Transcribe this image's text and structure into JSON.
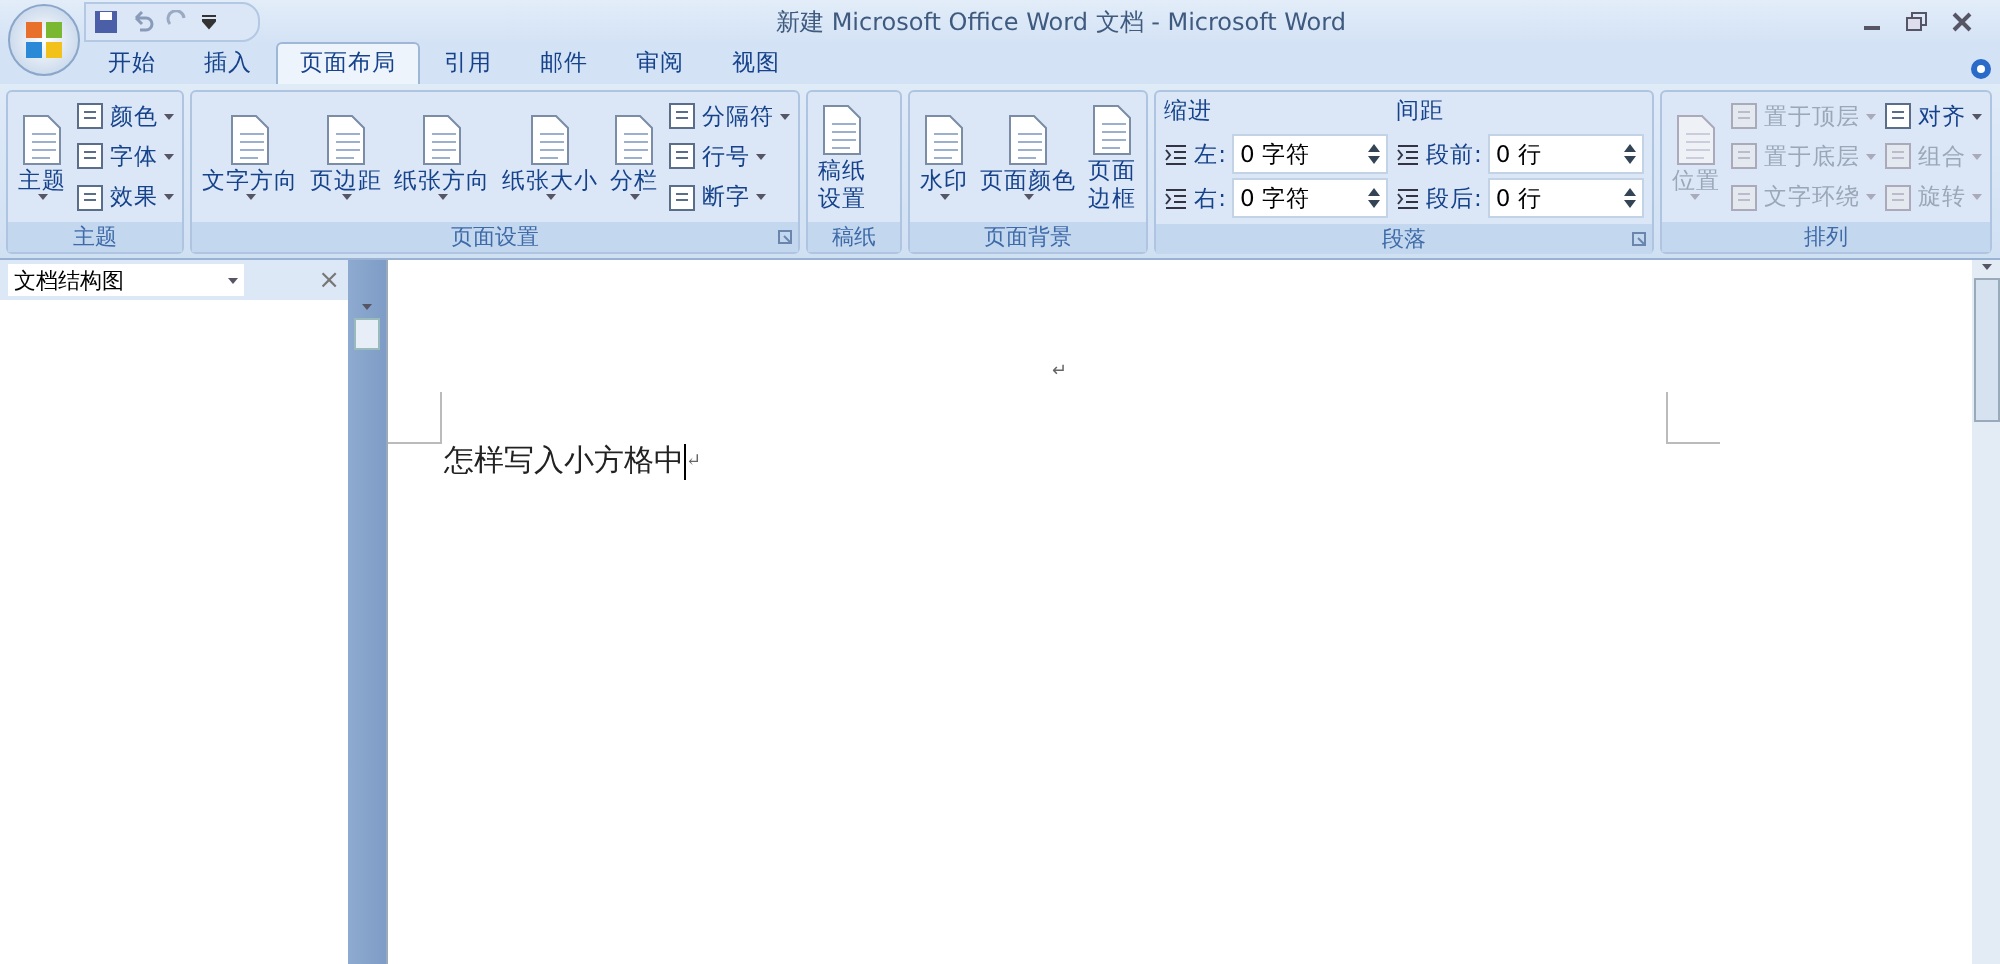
{
  "window": {
    "title": "新建 Microsoft Office Word 文档 - Microsoft Word"
  },
  "tabs": [
    {
      "label": "开始",
      "selected": false
    },
    {
      "label": "插入",
      "selected": false
    },
    {
      "label": "页面布局",
      "selected": true
    },
    {
      "label": "引用",
      "selected": false
    },
    {
      "label": "邮件",
      "selected": false
    },
    {
      "label": "审阅",
      "selected": false
    },
    {
      "label": "视图",
      "selected": false
    }
  ],
  "ribbon": {
    "groups": [
      {
        "label": "主题",
        "launcher": false,
        "columns": [
          [
            {
              "kind": "large",
              "label": "主题",
              "dropdown": true,
              "disabled": false
            }
          ],
          [
            {
              "kind": "small",
              "label": "颜色",
              "dropdown": true,
              "disabled": false
            },
            {
              "kind": "small",
              "label": "字体",
              "dropdown": true,
              "disabled": false
            },
            {
              "kind": "small",
              "label": "效果",
              "dropdown": true,
              "disabled": false
            }
          ]
        ]
      },
      {
        "label": "页面设置",
        "launcher": true,
        "columns": [
          [
            {
              "kind": "large",
              "label": "文字方向",
              "dropdown": true,
              "disabled": false
            }
          ],
          [
            {
              "kind": "large",
              "label": "页边距",
              "dropdown": true,
              "disabled": false
            }
          ],
          [
            {
              "kind": "large",
              "label": "纸张方向",
              "dropdown": true,
              "disabled": false
            }
          ],
          [
            {
              "kind": "large",
              "label": "纸张大小",
              "dropdown": true,
              "disabled": false
            }
          ],
          [
            {
              "kind": "large",
              "label": "分栏",
              "dropdown": true,
              "disabled": false
            }
          ],
          [
            {
              "kind": "small",
              "label": "分隔符",
              "dropdown": true,
              "disabled": false
            },
            {
              "kind": "small",
              "label": "行号",
              "dropdown": true,
              "disabled": false
            },
            {
              "kind": "small",
              "label": "断字",
              "dropdown": true,
              "disabled": false
            }
          ]
        ]
      },
      {
        "label": "稿纸",
        "launcher": false,
        "columns": [
          [
            {
              "kind": "large",
              "label": "稿纸设置",
              "dropdown": false,
              "disabled": false
            }
          ]
        ]
      },
      {
        "label": "页面背景",
        "launcher": false,
        "columns": [
          [
            {
              "kind": "large",
              "label": "水印",
              "dropdown": true,
              "disabled": false
            }
          ],
          [
            {
              "kind": "large",
              "label": "页面颜色",
              "dropdown": true,
              "disabled": false
            }
          ],
          [
            {
              "kind": "large",
              "label": "页面边框",
              "dropdown": false,
              "disabled": false
            }
          ]
        ]
      },
      {
        "label": "段落",
        "launcher": true,
        "columns": [
          [
            {
              "kind": "heading",
              "label": "缩进"
            },
            {
              "kind": "spin",
              "label": "左:",
              "value": "0 字符"
            },
            {
              "kind": "spin",
              "label": "右:",
              "value": "0 字符"
            }
          ],
          [
            {
              "kind": "heading",
              "label": "间距"
            },
            {
              "kind": "spin",
              "label": "段前:",
              "value": "0 行"
            },
            {
              "kind": "spin",
              "label": "段后:",
              "value": "0 行"
            }
          ]
        ]
      },
      {
        "label": "排列",
        "launcher": false,
        "columns": [
          [
            {
              "kind": "large",
              "label": "位置",
              "dropdown": true,
              "disabled": true
            }
          ],
          [
            {
              "kind": "small",
              "label": "置于顶层",
              "dropdown": true,
              "disabled": true
            },
            {
              "kind": "small",
              "label": "置于底层",
              "dropdown": true,
              "disabled": true
            },
            {
              "kind": "small",
              "label": "文字环绕",
              "dropdown": true,
              "disabled": true
            }
          ],
          [
            {
              "kind": "small",
              "label": "对齐",
              "dropdown": true,
              "disabled": false
            },
            {
              "kind": "small",
              "label": "组合",
              "dropdown": true,
              "disabled": true
            },
            {
              "kind": "small",
              "label": "旋转",
              "dropdown": true,
              "disabled": true
            }
          ]
        ]
      }
    ]
  },
  "nav_pane": {
    "title": "文档结构图",
    "close": "×"
  },
  "document": {
    "mark_top": "↵",
    "text": "怎样写入小方格中",
    "mark_end": "↵"
  }
}
